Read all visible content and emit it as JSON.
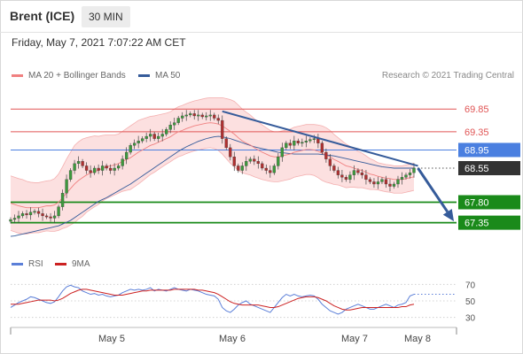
{
  "header": {
    "instrument": "Brent (ICE)",
    "timeframe": "30 MIN",
    "datetime": "Friday, May 7, 2021 7:07:22 AM CET"
  },
  "credit": "Research © 2021 Trading Central",
  "colors": {
    "ma20": "#f08080",
    "bands": "#fbd5d5",
    "ma50": "#355b9a",
    "candle_up": "#3d9a3d",
    "candle_down": "#b03030",
    "resistance": "#e05555",
    "pivot": "#4a7fe0",
    "support": "#1a8a1a",
    "current": "#333333",
    "arrow": "#355b9a",
    "rsi": "#5b7fd8",
    "rsi_ma": "#cc2222"
  },
  "chart_data": [
    {
      "type": "line",
      "subtype": "candlestick",
      "title": "Brent (ICE)",
      "timeframe": "30 MIN",
      "ylim": [
        66.7,
        70.4
      ],
      "x_ticks": [
        "May 5",
        "May 6",
        "May 7",
        "May 8"
      ],
      "legend": [
        {
          "label": "MA 20 + Bollinger Bands",
          "icon": "pink-line"
        },
        {
          "label": "MA 50",
          "icon": "blue-line"
        }
      ],
      "close": [
        67.42,
        67.45,
        67.5,
        67.55,
        67.52,
        67.58,
        67.6,
        67.55,
        67.5,
        67.48,
        67.45,
        67.5,
        67.7,
        68.0,
        68.3,
        68.5,
        68.65,
        68.7,
        68.6,
        68.5,
        68.45,
        68.55,
        68.5,
        68.6,
        68.55,
        68.5,
        68.55,
        68.6,
        68.75,
        68.9,
        69.05,
        69.1,
        69.15,
        69.2,
        69.25,
        69.3,
        69.2,
        69.25,
        69.3,
        69.4,
        69.5,
        69.55,
        69.65,
        69.7,
        69.72,
        69.75,
        69.7,
        69.72,
        69.68,
        69.7,
        69.72,
        69.65,
        69.6,
        69.2,
        69.0,
        68.8,
        68.6,
        68.5,
        68.6,
        68.7,
        68.75,
        68.7,
        68.65,
        68.55,
        68.5,
        68.45,
        68.6,
        68.8,
        69.0,
        69.1,
        69.05,
        69.15,
        69.1,
        69.12,
        69.15,
        69.18,
        69.2,
        69.1,
        68.9,
        68.75,
        68.6,
        68.5,
        68.4,
        68.35,
        68.3,
        68.4,
        68.5,
        68.45,
        68.4,
        68.3,
        68.25,
        68.2,
        68.25,
        68.3,
        68.2,
        68.15,
        68.2,
        68.3,
        68.35,
        68.4,
        68.45,
        68.55
      ],
      "ma20": [
        67.78,
        67.75,
        67.72,
        67.7,
        67.68,
        67.68,
        67.68,
        67.68,
        67.7,
        67.72,
        67.72,
        67.74,
        67.8,
        67.9,
        68.0,
        68.1,
        68.2,
        68.28,
        68.34,
        68.4,
        68.44,
        68.48,
        68.5,
        68.55,
        68.58,
        68.6,
        68.62,
        68.65,
        68.7,
        68.74,
        68.78,
        68.84,
        68.9,
        68.95,
        69.0,
        69.05,
        69.08,
        69.12,
        69.16,
        69.2,
        69.24,
        69.3,
        69.35,
        69.38,
        69.42,
        69.45,
        69.48,
        69.5,
        69.52,
        69.54,
        69.55,
        69.54,
        69.52,
        69.48,
        69.42,
        69.36,
        69.3,
        69.22,
        69.15,
        69.1,
        69.06,
        69.0,
        68.95,
        68.9,
        68.86,
        68.82,
        68.8,
        68.8,
        68.82,
        68.84,
        68.86,
        68.9,
        68.92,
        68.94,
        68.96,
        68.96,
        68.95,
        68.92,
        68.88,
        68.84,
        68.8,
        68.74,
        68.7,
        68.65,
        68.6,
        68.58,
        68.55,
        68.52,
        68.5,
        68.46,
        68.42,
        68.4,
        68.37,
        68.35,
        68.33,
        68.32,
        68.3,
        68.3,
        68.3,
        68.32,
        68.34,
        68.36
      ],
      "ma50": [
        67.05,
        67.06,
        67.08,
        67.1,
        67.12,
        67.14,
        67.16,
        67.18,
        67.2,
        67.22,
        67.24,
        67.26,
        67.28,
        67.32,
        67.36,
        67.4,
        67.46,
        67.52,
        67.58,
        67.64,
        67.7,
        67.76,
        67.82,
        67.86,
        67.9,
        67.95,
        68.0,
        68.05,
        68.1,
        68.15,
        68.2,
        68.26,
        68.32,
        68.38,
        68.44,
        68.5,
        68.56,
        68.62,
        68.68,
        68.74,
        68.8,
        68.86,
        68.92,
        68.97,
        69.02,
        69.06,
        69.1,
        69.14,
        69.17,
        69.2,
        69.22,
        69.24,
        69.25,
        69.24,
        69.22,
        69.2,
        69.17,
        69.14,
        69.11,
        69.08,
        69.05,
        69.02,
        69.0,
        68.98,
        68.96,
        68.94,
        68.92,
        68.9,
        68.89,
        68.88,
        68.87,
        68.86,
        68.86,
        68.86,
        68.86,
        68.86,
        68.86,
        68.86,
        68.85,
        68.84,
        68.83,
        68.82,
        68.8,
        68.78,
        68.76,
        68.74,
        68.72,
        68.7,
        68.68,
        68.66,
        68.64,
        68.62,
        68.6,
        68.58,
        68.57,
        68.56,
        68.55,
        68.55,
        68.55,
        68.55,
        68.55,
        68.55
      ],
      "band_width": [
        0.6,
        0.6,
        0.6,
        0.6,
        0.58,
        0.56,
        0.55,
        0.55,
        0.55,
        0.55,
        0.56,
        0.58,
        0.62,
        0.68,
        0.75,
        0.8,
        0.85,
        0.85,
        0.85,
        0.82,
        0.8,
        0.78,
        0.75,
        0.72,
        0.7,
        0.68,
        0.66,
        0.65,
        0.66,
        0.68,
        0.7,
        0.7,
        0.7,
        0.68,
        0.66,
        0.64,
        0.62,
        0.6,
        0.58,
        0.56,
        0.55,
        0.55,
        0.55,
        0.55,
        0.55,
        0.55,
        0.55,
        0.55,
        0.55,
        0.55,
        0.55,
        0.56,
        0.58,
        0.62,
        0.66,
        0.7,
        0.72,
        0.72,
        0.7,
        0.68,
        0.66,
        0.64,
        0.62,
        0.6,
        0.58,
        0.56,
        0.55,
        0.55,
        0.55,
        0.55,
        0.55,
        0.55,
        0.55,
        0.55,
        0.55,
        0.55,
        0.56,
        0.58,
        0.6,
        0.6,
        0.58,
        0.55,
        0.52,
        0.5,
        0.48,
        0.45,
        0.42,
        0.4,
        0.38,
        0.36,
        0.34,
        0.32,
        0.3,
        0.3,
        0.3,
        0.3,
        0.3,
        0.3,
        0.3,
        0.3,
        0.3,
        0.3
      ],
      "levels": [
        {
          "value": 69.85,
          "label": "69.85",
          "kind": "resistance"
        },
        {
          "value": 69.35,
          "label": "69.35",
          "kind": "resistance"
        },
        {
          "value": 68.95,
          "label": "68.95",
          "kind": "pivot"
        },
        {
          "value": 68.55,
          "label": "68.55",
          "kind": "current"
        },
        {
          "value": 67.8,
          "label": "67.80",
          "kind": "support"
        },
        {
          "value": 67.35,
          "label": "67.35",
          "kind": "support"
        }
      ],
      "trendline": {
        "from": {
          "index": 53,
          "value": 69.8
        },
        "to": {
          "index": 102,
          "value": 68.6
        }
      },
      "forecast_arrow": {
        "from": {
          "index": 102,
          "value": 68.55
        },
        "to": {
          "index": 111,
          "value": 67.38
        }
      }
    },
    {
      "type": "line",
      "title": "RSI",
      "ylim": [
        20,
        80
      ],
      "y_ticks": [
        70,
        50,
        30
      ],
      "x_ticks": [
        "May 5",
        "May 6",
        "May 7",
        "May 8"
      ],
      "series": [
        {
          "name": "RSI",
          "values": [
            42,
            45,
            48,
            50,
            52,
            55,
            54,
            52,
            50,
            48,
            47,
            49,
            55,
            62,
            67,
            69,
            67,
            66,
            62,
            60,
            58,
            59,
            57,
            58,
            56,
            55,
            56,
            57,
            60,
            62,
            64,
            63,
            64,
            63,
            64,
            66,
            62,
            64,
            63,
            62,
            64,
            66,
            64,
            63,
            62,
            64,
            63,
            62,
            60,
            58,
            57,
            56,
            52,
            42,
            38,
            36,
            40,
            45,
            48,
            50,
            46,
            44,
            42,
            40,
            38,
            36,
            42,
            48,
            54,
            58,
            56,
            58,
            56,
            55,
            56,
            57,
            56,
            52,
            46,
            42,
            38,
            36,
            34,
            36,
            40,
            42,
            44,
            46,
            44,
            42,
            40,
            40,
            42,
            44,
            46,
            44,
            42,
            45,
            46,
            48,
            56,
            58
          ]
        },
        {
          "name": "9MA",
          "values": [
            46,
            46,
            46,
            47,
            48,
            49,
            50,
            51,
            51,
            51,
            51,
            50,
            51,
            53,
            56,
            59,
            61,
            63,
            64,
            64,
            63,
            62,
            61,
            60,
            59,
            58,
            57,
            57,
            57,
            58,
            59,
            60,
            61,
            62,
            62,
            63,
            63,
            63,
            63,
            63,
            63,
            64,
            64,
            64,
            64,
            64,
            64,
            63,
            63,
            62,
            61,
            60,
            58,
            55,
            52,
            49,
            47,
            46,
            45,
            45,
            45,
            45,
            45,
            44,
            43,
            42,
            42,
            43,
            45,
            47,
            49,
            51,
            53,
            54,
            55,
            55,
            55,
            54,
            52,
            50,
            47,
            44,
            42,
            40,
            39,
            39,
            40,
            41,
            42,
            42,
            42,
            42,
            42,
            42,
            42,
            42,
            42,
            42,
            43,
            43,
            45,
            46
          ]
        }
      ]
    }
  ]
}
